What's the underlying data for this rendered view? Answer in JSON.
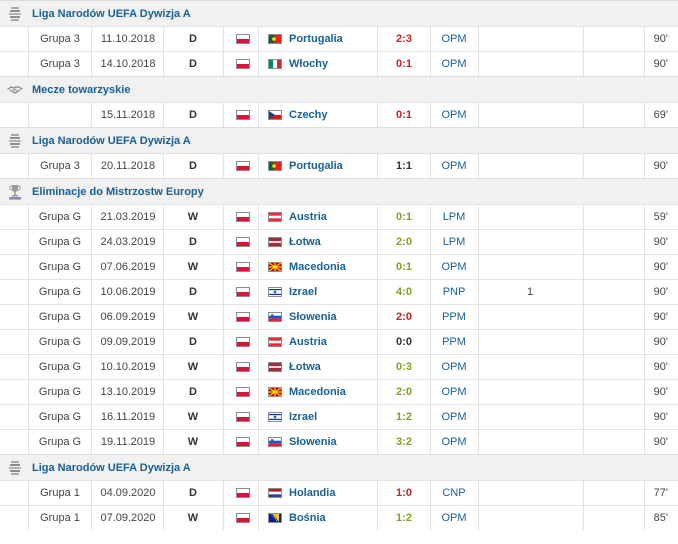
{
  "colors": {
    "link": "#17609a",
    "score_red": "#c3242a",
    "score_green": "#7aa421",
    "score_black": "#333333",
    "section_bg": "#f1f1f1"
  },
  "sections": [
    {
      "title": "Liga Narodów UEFA Dywizja A",
      "icon": "nations-league-icon",
      "rows": [
        {
          "group": "Grupa 3",
          "date": "11.10.2018",
          "res": "D",
          "opponent": "Portugalia",
          "flag": "portugal-flag-icon",
          "score": "2:3",
          "score_color": "red",
          "pos": "OPM",
          "goals": "",
          "min": "90'"
        },
        {
          "group": "Grupa 3",
          "date": "14.10.2018",
          "res": "D",
          "opponent": "Włochy",
          "flag": "italy-flag-icon",
          "score": "0:1",
          "score_color": "red",
          "pos": "OPM",
          "goals": "",
          "min": "90'"
        }
      ]
    },
    {
      "title": "Mecze towarzyskie",
      "icon": "handshake-icon",
      "rows": [
        {
          "group": "",
          "date": "15.11.2018",
          "res": "D",
          "opponent": "Czechy",
          "flag": "czech-flag-icon",
          "score": "0:1",
          "score_color": "red",
          "pos": "OPM",
          "goals": "",
          "min": "69'"
        }
      ]
    },
    {
      "title": "Liga Narodów UEFA Dywizja A",
      "icon": "nations-league-icon",
      "rows": [
        {
          "group": "Grupa 3",
          "date": "20.11.2018",
          "res": "D",
          "opponent": "Portugalia",
          "flag": "portugal-flag-icon",
          "score": "1:1",
          "score_color": "black",
          "pos": "OPM",
          "goals": "",
          "min": "90'"
        }
      ]
    },
    {
      "title": "Eliminacje do Mistrzostw Europy",
      "icon": "euro-qualifiers-icon",
      "rows": [
        {
          "group": "Grupa G",
          "date": "21.03.2019",
          "res": "W",
          "opponent": "Austria",
          "flag": "austria-flag-icon",
          "score": "0:1",
          "score_color": "green",
          "pos": "LPM",
          "goals": "",
          "min": "59'"
        },
        {
          "group": "Grupa G",
          "date": "24.03.2019",
          "res": "D",
          "opponent": "Łotwa",
          "flag": "latvia-flag-icon",
          "score": "2:0",
          "score_color": "green",
          "pos": "LPM",
          "goals": "",
          "min": "90'"
        },
        {
          "group": "Grupa G",
          "date": "07.06.2019",
          "res": "W",
          "opponent": "Macedonia",
          "flag": "macedonia-flag-icon",
          "score": "0:1",
          "score_color": "green",
          "pos": "OPM",
          "goals": "",
          "min": "90'"
        },
        {
          "group": "Grupa G",
          "date": "10.06.2019",
          "res": "D",
          "opponent": "Izrael",
          "flag": "israel-flag-icon",
          "score": "4:0",
          "score_color": "green",
          "pos": "PNP",
          "goals": "1",
          "min": "90'"
        },
        {
          "group": "Grupa G",
          "date": "06.09.2019",
          "res": "W",
          "opponent": "Słowenia",
          "flag": "slovenia-flag-icon",
          "score": "2:0",
          "score_color": "red",
          "pos": "PPM",
          "goals": "",
          "min": "90'"
        },
        {
          "group": "Grupa G",
          "date": "09.09.2019",
          "res": "D",
          "opponent": "Austria",
          "flag": "austria-flag-icon",
          "score": "0:0",
          "score_color": "black",
          "pos": "PPM",
          "goals": "",
          "min": "90'"
        },
        {
          "group": "Grupa G",
          "date": "10.10.2019",
          "res": "W",
          "opponent": "Łotwa",
          "flag": "latvia-flag-icon",
          "score": "0:3",
          "score_color": "green",
          "pos": "OPM",
          "goals": "",
          "min": "90'"
        },
        {
          "group": "Grupa G",
          "date": "13.10.2019",
          "res": "D",
          "opponent": "Macedonia",
          "flag": "macedonia-flag-icon",
          "score": "2:0",
          "score_color": "green",
          "pos": "OPM",
          "goals": "",
          "min": "90'"
        },
        {
          "group": "Grupa G",
          "date": "16.11.2019",
          "res": "W",
          "opponent": "Izrael",
          "flag": "israel-flag-icon",
          "score": "1:2",
          "score_color": "green",
          "pos": "OPM",
          "goals": "",
          "min": "90'"
        },
        {
          "group": "Grupa G",
          "date": "19.11.2019",
          "res": "W",
          "opponent": "Słowenia",
          "flag": "slovenia-flag-icon",
          "score": "3:2",
          "score_color": "green",
          "pos": "OPM",
          "goals": "",
          "min": "90'"
        }
      ]
    },
    {
      "title": "Liga Narodów UEFA Dywizja A",
      "icon": "nations-league-icon",
      "rows": [
        {
          "group": "Grupa 1",
          "date": "04.09.2020",
          "res": "D",
          "opponent": "Holandia",
          "flag": "netherlands-flag-icon",
          "score": "1:0",
          "score_color": "red",
          "pos": "CNP",
          "goals": "",
          "min": "77'"
        },
        {
          "group": "Grupa 1",
          "date": "07.09.2020",
          "res": "W",
          "opponent": "Bośnia",
          "flag": "bosnia-flag-icon",
          "score": "1:2",
          "score_color": "green",
          "pos": "OPM",
          "goals": "",
          "min": "85'"
        }
      ]
    }
  ]
}
